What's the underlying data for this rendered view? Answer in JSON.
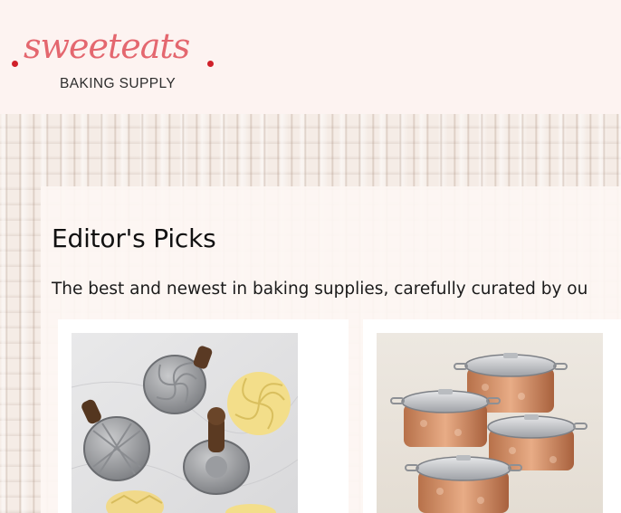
{
  "brand": {
    "name": "sweeteats",
    "tagline": "BAKING SUPPLY"
  },
  "main": {
    "title": "Editor's Picks",
    "intro": "The best and newest in baking supplies, carefully curated by ou"
  },
  "products": [
    {
      "image_icon": "cookie-stamps-image"
    },
    {
      "image_icon": "copper-cocottes-image"
    }
  ],
  "colors": {
    "brand_pink": "#e4676f",
    "brand_red_dot": "#d0202a",
    "header_bg": "#fdf3f1"
  }
}
